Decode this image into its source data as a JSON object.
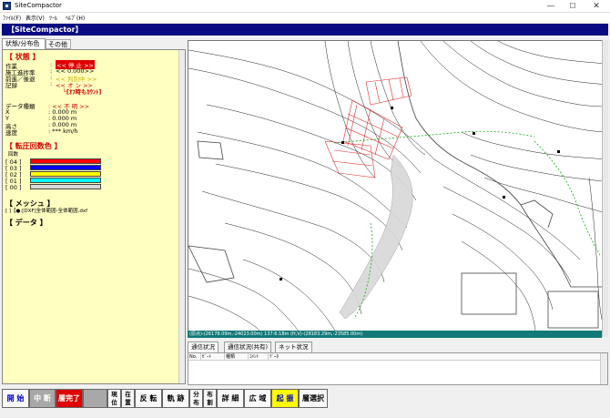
{
  "window": {
    "title": "SiteCompactor",
    "minimize": "—",
    "maximize": "☐",
    "close": "✕"
  },
  "menu": [
    "ﾌｧｲﾙ(F)",
    "表示(V)",
    "ﾂｰﾙ",
    "ﾍﾙﾌﾟ(H)"
  ],
  "app_header": "【SiteCompactor】",
  "tabs": [
    "状態/分布色",
    "その他"
  ],
  "status_panel": {
    "heading": "【 状態 】",
    "rows": [
      {
        "label": "作業",
        "sep": ":",
        "value": "<< 停 止 >>"
      },
      {
        "label": "施工進捗率",
        "sep": ":",
        "value": "<<     0.000>>"
      },
      {
        "label": "前進／後退",
        "sep": ":",
        "value": "<< 判別中 >>"
      },
      {
        "label": "記録",
        "sep": ":",
        "value": "<< オ ン >>"
      }
    ],
    "record_note": "└[ｵﾌ時もｶｳﾝﾄ]",
    "data_type_label": "データ種類",
    "data_type_value": ": << 不  明 >>",
    "coords": [
      {
        "label": "X",
        "value": ":        0.000 m"
      },
      {
        "label": "Y",
        "value": ":        0.000 m"
      },
      {
        "label": "高さ",
        "value": ":        0.000 m"
      },
      {
        "label": "速度",
        "value": ":       *** km/h"
      }
    ]
  },
  "roller_colors": {
    "heading": "【 転圧回数色 】",
    "sub": "回数",
    "rows": [
      {
        "label": "[ 04 ]",
        "color": "#ff0000"
      },
      {
        "label": "[ 03 ]",
        "color": "#0000ff"
      },
      {
        "label": "[ 02 ]",
        "color": "#ffff00"
      },
      {
        "label": "[ 01 ]",
        "color": "#00ffff"
      },
      {
        "label": "[ 00 ]",
        "color": "#d8d8d8"
      }
    ]
  },
  "mesh": {
    "heading": "【 メッシュ 】",
    "item": "[ ]【●:[DXF]全体範囲-全体範囲.dxf"
  },
  "data_section": {
    "heading": "【 データ 】"
  },
  "map_status": "(原点)-(26178.09m,-24023.00m) 137:6:18m (H,V)-(28183.29m,-23585.00m)",
  "comm_tabs": [
    "通信状況",
    "通信状況(共有)",
    "ネット状況"
  ],
  "comm_columns": [
    "No.",
    "ｾﾞｰﾄ",
    "種類",
    "ｺﾒﾝﾄ",
    "ﾃﾞｰﾀ"
  ],
  "toolbar": [
    {
      "label": "開 始",
      "style": "blue"
    },
    {
      "label": "中 断",
      "style": "gray"
    },
    {
      "label": "層完了",
      "style": "redbg"
    },
    {
      "label": "",
      "style": "blank"
    },
    {
      "label": "現\n位",
      "style": "two"
    },
    {
      "label": "在\n置",
      "style": "two"
    },
    {
      "label": "反 転",
      "style": ""
    },
    {
      "label": "軌 跡",
      "style": ""
    },
    {
      "label": "分\n布",
      "style": "two"
    },
    {
      "label": "布\n割",
      "style": "two"
    },
    {
      "label": "詳 細",
      "style": ""
    },
    {
      "label": "広 域",
      "style": ""
    },
    {
      "label": "起 振",
      "style": "yelbg"
    },
    {
      "label": "層選択",
      "style": ""
    }
  ]
}
